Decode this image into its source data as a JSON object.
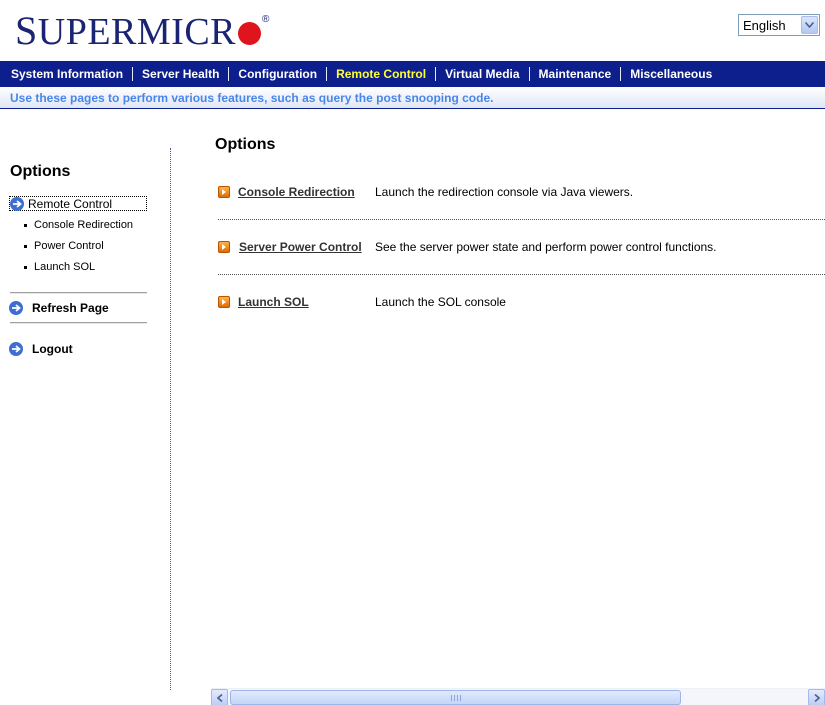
{
  "brand": {
    "name_first": "S",
    "name_rest": "UPERMICR",
    "reg": "®"
  },
  "language": {
    "selected": "English"
  },
  "nav": {
    "items": [
      {
        "label": "System Information"
      },
      {
        "label": "Server Health"
      },
      {
        "label": "Configuration"
      },
      {
        "label": "Remote Control",
        "active": true
      },
      {
        "label": "Virtual Media"
      },
      {
        "label": "Maintenance"
      },
      {
        "label": "Miscellaneous"
      }
    ]
  },
  "subbar": {
    "text": "Use these pages to perform various features, such as query the post snooping code."
  },
  "sidebar": {
    "title": "Options",
    "section": "Remote Control",
    "subitems": [
      "Console Redirection",
      "Power Control",
      "Launch SOL"
    ],
    "refresh": "Refresh Page",
    "logout": "Logout"
  },
  "main": {
    "title": "Options",
    "options": [
      {
        "link": "Console Redirection",
        "desc": "Launch the redirection console via Java viewers."
      },
      {
        "link": "Server Power Control",
        "desc": "See the server power state and perform power control functions."
      },
      {
        "link": "Launch SOL",
        "desc": "Launch the SOL console"
      }
    ]
  },
  "colors": {
    "brand_blue": "#1a2472",
    "brand_red": "#e0141c",
    "nav_bg": "#0d1f8c",
    "nav_active": "#ffff33",
    "subbar_text": "#4a86e8"
  }
}
